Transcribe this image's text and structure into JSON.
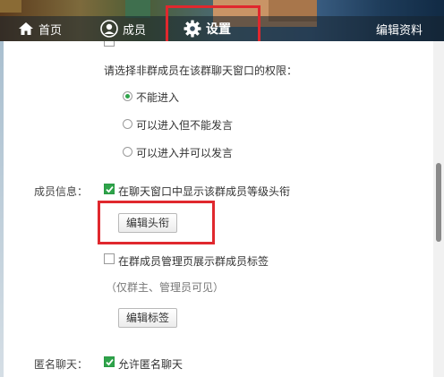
{
  "header": {
    "tabs": [
      {
        "label": "首页",
        "icon": "home-icon"
      },
      {
        "label": "成员",
        "icon": "user-icon"
      },
      {
        "label": "设置",
        "icon": "gear-icon",
        "active": true
      }
    ],
    "edit_profile": "编辑资料"
  },
  "settings": {
    "permission_prompt": "请选择非群成员在该群聊天窗口的权限：",
    "permission_options": [
      {
        "label": "不能进入",
        "selected": true
      },
      {
        "label": "可以进入但不能发言",
        "selected": false
      },
      {
        "label": "可以进入并可以发言",
        "selected": false
      }
    ],
    "member_info": {
      "label": "成员信息：",
      "show_title_checkbox": "在聊天窗口中显示该群成员等级头衔",
      "show_title_checked": true,
      "edit_title_button": "编辑头衔",
      "show_tags_checkbox": "在群成员管理页展示群成员标签",
      "show_tags_checked": false,
      "visibility_note": "（仅群主、管理员可见）",
      "edit_tags_button": "编辑标签"
    },
    "anonymous_chat": {
      "label": "匿名聊天：",
      "allow_checkbox": "允许匿名聊天",
      "allow_checked": true
    }
  },
  "colors": {
    "highlight_box": "#e0282e",
    "check_green": "#2ea34a"
  }
}
